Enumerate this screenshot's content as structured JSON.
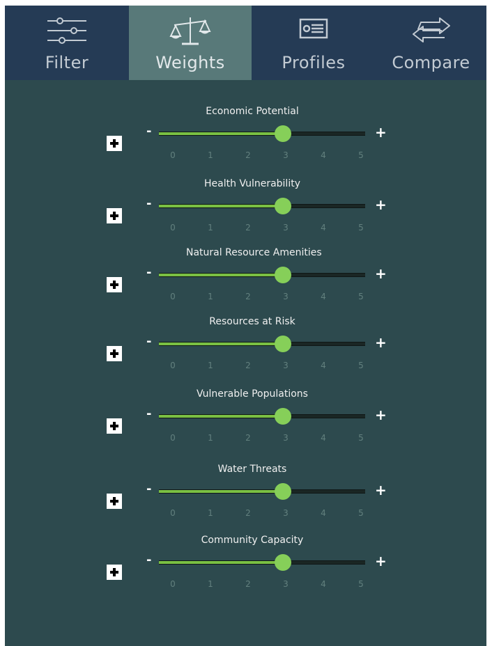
{
  "tabs": [
    {
      "label": "Filter",
      "icon": "sliders-icon",
      "active": false
    },
    {
      "label": "Weights",
      "icon": "balance-scale-icon",
      "active": true
    },
    {
      "label": "Profiles",
      "icon": "id-card-icon",
      "active": false
    },
    {
      "label": "Compare",
      "icon": "swap-arrows-icon",
      "active": false
    }
  ],
  "slider_scale": {
    "min": 0,
    "max": 5,
    "ticks": [
      "0",
      "1",
      "2",
      "3",
      "4",
      "5"
    ],
    "minus_label": "-",
    "plus_label": "+"
  },
  "weights": [
    {
      "label": "Economic Potential",
      "value": 3
    },
    {
      "label": "Health Vulnerability",
      "value": 3
    },
    {
      "label": "Natural Resource Amenities",
      "value": 3
    },
    {
      "label": "Resources at Risk",
      "value": 3
    },
    {
      "label": "Vulnerable Populations",
      "value": 3
    },
    {
      "label": "Water Threats",
      "value": 3
    },
    {
      "label": "Community Capacity",
      "value": 3
    }
  ],
  "colors": {
    "panel_bg": "#2d4a4e",
    "tabbar_bg": "#253b55",
    "active_tab_bg": "#587979",
    "slider_fill": "#7ac043",
    "slider_thumb": "#86cf59"
  }
}
